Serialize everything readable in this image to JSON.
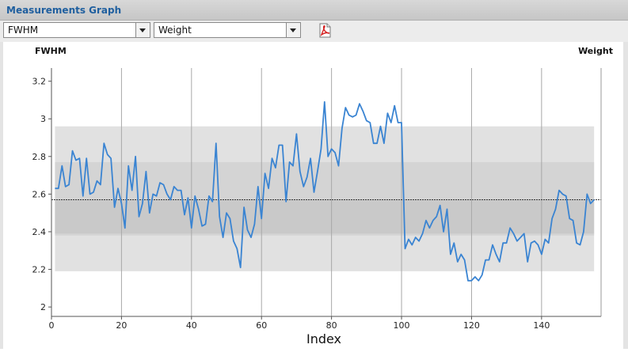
{
  "panel": {
    "title": "Measurements Graph"
  },
  "toolbar": {
    "y_selector": {
      "value": "FWHM"
    },
    "weight_selector": {
      "value": "Weight"
    },
    "pdf_export_icon": "pdf-export-icon"
  },
  "colors": {
    "line": "#3a84d2",
    "band_outer": "#e1e1e1",
    "band_middle": "#d4d4d4",
    "band_inner": "#c9c9c9",
    "mean_line": "#333333",
    "title_text": "#1f5f9f"
  },
  "chart_data": {
    "type": "line",
    "title": "",
    "ylabel_left": "FWHM",
    "label_right": "Weight",
    "xlabel": "Index",
    "xlim": [
      0,
      157
    ],
    "ylim": [
      1.95,
      3.27
    ],
    "xticks": [
      0,
      20,
      40,
      60,
      80,
      100,
      120,
      140
    ],
    "yticks": [
      2,
      2.2,
      2.4,
      2.6,
      2.8,
      3,
      3.2
    ],
    "ytick_labels": [
      "2",
      "2.2",
      "2.4",
      "2.6",
      "2.8",
      "3",
      "3.2"
    ],
    "grid": "vertical",
    "mean": 2.57,
    "bands": [
      {
        "name": "outer",
        "range": [
          2.19,
          2.96
        ]
      },
      {
        "name": "middle",
        "range": [
          2.38,
          2.77
        ]
      },
      {
        "name": "inner",
        "range": [
          2.39,
          2.57
        ]
      }
    ],
    "series": [
      {
        "x": [
          1,
          2,
          3,
          4,
          5,
          6,
          7,
          8,
          9,
          10,
          11,
          12,
          13,
          14,
          15,
          16,
          17,
          18,
          19,
          20,
          21,
          22,
          23,
          24,
          25,
          26,
          27,
          28,
          29,
          30,
          31,
          32,
          33,
          34,
          35,
          36,
          37,
          38,
          39,
          40,
          41,
          42,
          43,
          44,
          45,
          46,
          47,
          48,
          49,
          50,
          51,
          52,
          53,
          54,
          55,
          56,
          57,
          58,
          59,
          60,
          61,
          62,
          63,
          64,
          65,
          66,
          67,
          68,
          69,
          70,
          71,
          72,
          73,
          74,
          75,
          76,
          77,
          78,
          79,
          80,
          81,
          82,
          83,
          84,
          85,
          86,
          87,
          88,
          89,
          90,
          91,
          92,
          93,
          94,
          95,
          96,
          97,
          98,
          99,
          100,
          101,
          102,
          103,
          104,
          105,
          106,
          107,
          108,
          109,
          110,
          111,
          112,
          113,
          114,
          115,
          116,
          117,
          118,
          119,
          120,
          121,
          122,
          123,
          124,
          125,
          126,
          127,
          128,
          129,
          130,
          131,
          132,
          133,
          134,
          135,
          136,
          137,
          138,
          139,
          140,
          141,
          142,
          143,
          144,
          145,
          146,
          147,
          148,
          149,
          150,
          151,
          152,
          153,
          154,
          155
        ],
        "values": [
          2.63,
          2.63,
          2.75,
          2.64,
          2.65,
          2.83,
          2.78,
          2.79,
          2.59,
          2.79,
          2.6,
          2.61,
          2.67,
          2.65,
          2.87,
          2.81,
          2.79,
          2.53,
          2.63,
          2.55,
          2.42,
          2.75,
          2.62,
          2.8,
          2.48,
          2.55,
          2.72,
          2.5,
          2.6,
          2.59,
          2.66,
          2.65,
          2.6,
          2.57,
          2.64,
          2.62,
          2.62,
          2.49,
          2.58,
          2.42,
          2.59,
          2.52,
          2.43,
          2.44,
          2.59,
          2.56,
          2.87,
          2.48,
          2.37,
          2.5,
          2.47,
          2.35,
          2.31,
          2.21,
          2.53,
          2.41,
          2.37,
          2.44,
          2.64,
          2.47,
          2.71,
          2.63,
          2.79,
          2.74,
          2.86,
          2.86,
          2.56,
          2.77,
          2.75,
          2.92,
          2.72,
          2.64,
          2.69,
          2.79,
          2.61,
          2.72,
          2.84,
          3.09,
          2.8,
          2.84,
          2.82,
          2.75,
          2.95,
          3.06,
          3.02,
          3.01,
          3.02,
          3.08,
          3.04,
          2.99,
          2.98,
          2.87,
          2.87,
          2.96,
          2.87,
          3.03,
          2.98,
          3.07,
          2.98,
          2.98,
          2.31,
          2.36,
          2.33,
          2.37,
          2.35,
          2.39,
          2.46,
          2.42,
          2.46,
          2.48,
          2.54,
          2.4,
          2.52,
          2.28,
          2.34,
          2.24,
          2.28,
          2.25,
          2.14,
          2.14,
          2.16,
          2.14,
          2.17,
          2.25,
          2.25,
          2.33,
          2.28,
          2.24,
          2.34,
          2.34,
          2.42,
          2.39,
          2.35,
          2.37,
          2.39,
          2.24,
          2.34,
          2.35,
          2.33,
          2.28,
          2.36,
          2.34,
          2.47,
          2.52,
          2.62,
          2.6,
          2.59,
          2.47,
          2.46,
          2.34,
          2.33,
          2.4,
          2.6,
          2.55,
          2.57
        ]
      }
    ]
  }
}
